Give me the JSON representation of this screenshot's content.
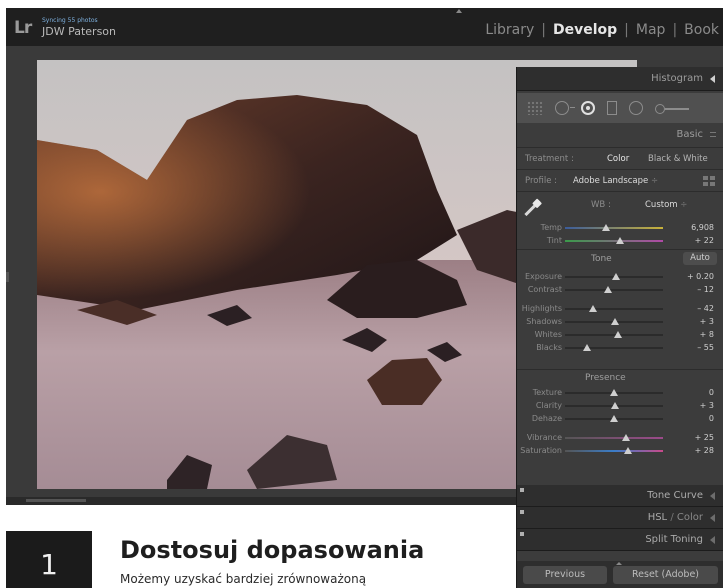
{
  "topbar": {
    "logo": "Lr",
    "sync_status": "Syncing 55 photos",
    "identity": "JDW Paterson",
    "modules": [
      "Library",
      "Develop",
      "Map",
      "Book"
    ],
    "active_module": "Develop",
    "separator": "|"
  },
  "panel": {
    "histogram_title": "Histogram",
    "basic_title": "Basic",
    "treatment": {
      "label": "Treatment :",
      "color": "Color",
      "bw": "Black & White"
    },
    "profile": {
      "label": "Profile :",
      "value": "Adobe Landscape",
      "caret": "÷"
    },
    "wb": {
      "label": "WB :",
      "value": "Custom",
      "caret": "÷"
    },
    "sliders_wb": [
      {
        "name": "Temp",
        "value": "6,908",
        "pos": 0.42
      },
      {
        "name": "Tint",
        "value": "+ 22",
        "pos": 0.56
      }
    ],
    "tone_title": "Tone",
    "auto_label": "Auto",
    "sliders_tone": [
      {
        "name": "Exposure",
        "value": "+ 0.20",
        "pos": 0.52
      },
      {
        "name": "Contrast",
        "value": "– 12",
        "pos": 0.44
      },
      {
        "name": "Highlights",
        "value": "– 42",
        "pos": 0.29
      },
      {
        "name": "Shadows",
        "value": "+ 3",
        "pos": 0.51
      },
      {
        "name": "Whites",
        "value": "+ 8",
        "pos": 0.54
      },
      {
        "name": "Blacks",
        "value": "– 55",
        "pos": 0.22
      }
    ],
    "presence_title": "Presence",
    "sliders_presence": [
      {
        "name": "Texture",
        "value": "0",
        "pos": 0.5
      },
      {
        "name": "Clarity",
        "value": "+ 3",
        "pos": 0.51
      },
      {
        "name": "Dehaze",
        "value": "0",
        "pos": 0.5
      },
      {
        "name": "Vibrance",
        "value": "+ 25",
        "pos": 0.62
      },
      {
        "name": "Saturation",
        "value": "+ 28",
        "pos": 0.64
      }
    ],
    "tone_curve_title": "Tone Curve",
    "hsl_title": "HSL",
    "hsl_sep": "/",
    "hsl_color": "Color",
    "split_toning_title": "Split Toning",
    "previous_label": "Previous",
    "reset_label": "Reset (Adobe)"
  },
  "article": {
    "step_number": "1",
    "title": "Dostosuj dopasowania",
    "subtitle": "Możemy uzyskać bardziej zrównoważoną"
  },
  "colors": {
    "panel_bg": "#3c3c3c",
    "topbar_bg": "#1f1f1f",
    "active_module": "#e6e6e6"
  }
}
